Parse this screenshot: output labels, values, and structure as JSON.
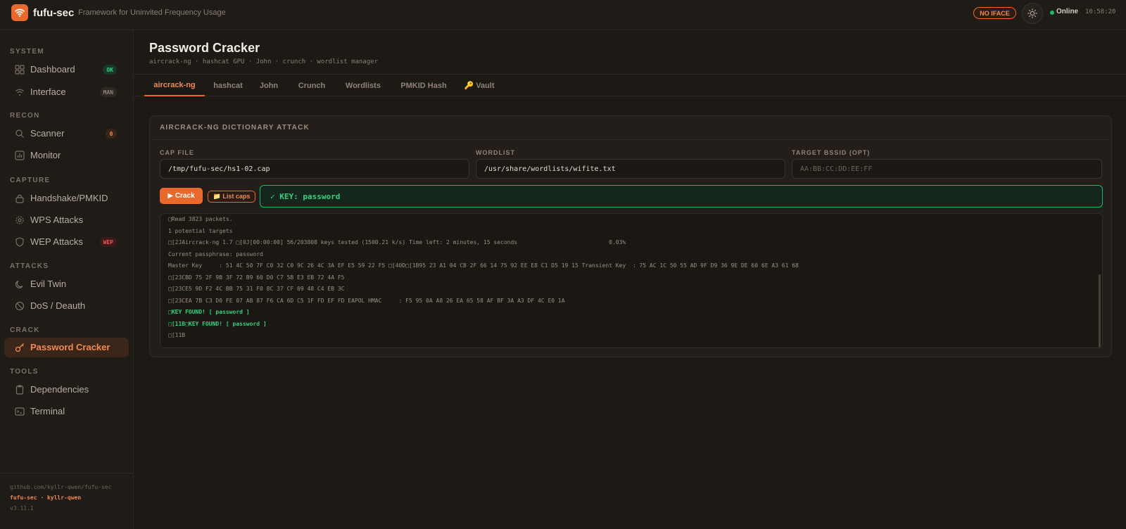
{
  "app": {
    "name": "fufu-sec",
    "tagline": "Framework for Uninvited Frequency Usage",
    "iface_badge": "NO IFACE",
    "status": "Online",
    "clock": "10:58:20"
  },
  "sidebar": {
    "sections": [
      {
        "label": "SYSTEM"
      },
      {
        "label": "RECON"
      },
      {
        "label": "CAPTURE"
      },
      {
        "label": "ATTACKS"
      },
      {
        "label": "CRACK"
      },
      {
        "label": "TOOLS"
      }
    ],
    "items": [
      {
        "label": "Dashboard",
        "badge": "OK",
        "icon": "grid-icon"
      },
      {
        "label": "Interface",
        "badge": "MAN",
        "icon": "wifi-icon"
      },
      {
        "label": "Scanner",
        "badge": "0",
        "icon": "search-icon"
      },
      {
        "label": "Monitor",
        "icon": "bar-chart-icon"
      },
      {
        "label": "Handshake/PMKID",
        "icon": "lock-icon"
      },
      {
        "label": "WPS Attacks",
        "icon": "gear-icon"
      },
      {
        "label": "WEP Attacks",
        "badge": "WEP",
        "icon": "shield-icon"
      },
      {
        "label": "Evil Twin",
        "icon": "moon-icon"
      },
      {
        "label": "DoS / Deauth",
        "icon": "ban-icon"
      },
      {
        "label": "Password Cracker",
        "icon": "key-icon"
      },
      {
        "label": "Dependencies",
        "icon": "clipboard-icon"
      },
      {
        "label": "Terminal",
        "icon": "terminal-icon"
      }
    ],
    "footer": {
      "repo": "github.com/kyllr-qwen/fufu-sec",
      "credit": "fufu-sec · kyllr-qwen",
      "version": "v3.11.1"
    }
  },
  "page": {
    "title": "Password Cracker",
    "subtitle": "aircrack-ng · hashcat GPU · John · crunch · wordlist manager"
  },
  "tabs": [
    {
      "label": "aircrack-ng"
    },
    {
      "label": "hashcat"
    },
    {
      "label": "John"
    },
    {
      "label": "Crunch"
    },
    {
      "label": "Wordlists"
    },
    {
      "label": "PMKID Hash"
    },
    {
      "label": "🔑 Vault"
    }
  ],
  "card": {
    "title": "AIRCRACK-NG DICTIONARY ATTACK",
    "cap_label": "CAP FILE",
    "cap_value": "/tmp/fufu-sec/hs1-02.cap",
    "wordlist_label": "WORDLIST",
    "wordlist_value": "/usr/share/wordlists/wifite.txt",
    "bssid_label": "TARGET BSSID (OPT)",
    "bssid_placeholder": "AA:BB:CC:DD:EE:FF",
    "crack_button": "▶ Crack",
    "list_button": "📁 List caps",
    "result": "✓ KEY: password"
  },
  "terminal": {
    "lines": [
      {
        "text": "□Read 3823 packets."
      },
      {
        "text": "1 potential targets"
      },
      {
        "text": "□[2JAircrack-ng 1.7 □[0J[00:00:00] 56/203808 keys tested (1500.21 k/s) Time left: 2 minutes, 15 seconds                           0.03%"
      },
      {
        "text": "Current passphrase: password"
      },
      {
        "text": "Master Key     : 51 4C 50 7F C0 32 C0 9C 26 4C 3A EF E5 59 22 F5 □[40D□[1B95 23 A1 04 CB 2F 66 14 75 92 EE E8 C1 D5 19 15 Transient Key  : 75 AC 1C 50 55 AD 9F D9 36 9E DE 60 6E A3 61 68"
      },
      {
        "text": "□[23CBD 75 2F 9B 3F 72 B9 60 D0 C7 5B E3 EB 72 4A F5"
      },
      {
        "text": "□[23CE5 9D F2 4C BB 75 31 F0 8C 37 CF 09 48 C4 EB 3C"
      },
      {
        "text": "□[23CEA 7B C3 D0 FE 07 AB 87 F6 CA 6D C5 1F FD EF FD EAPOL HMAC     : F5 95 0A A8 26 EA 65 58 AF BF 3A A3 DF 4C E0 1A"
      },
      {
        "text": "□KEY FOUND! [ password ]",
        "found": true
      },
      {
        "text": "□[11B□KEY FOUND! [ password ]",
        "found": true
      },
      {
        "text": "□[11B"
      }
    ]
  },
  "colors": {
    "accent": "#e8692b",
    "success": "#36d07f",
    "background": "#1d1915"
  }
}
